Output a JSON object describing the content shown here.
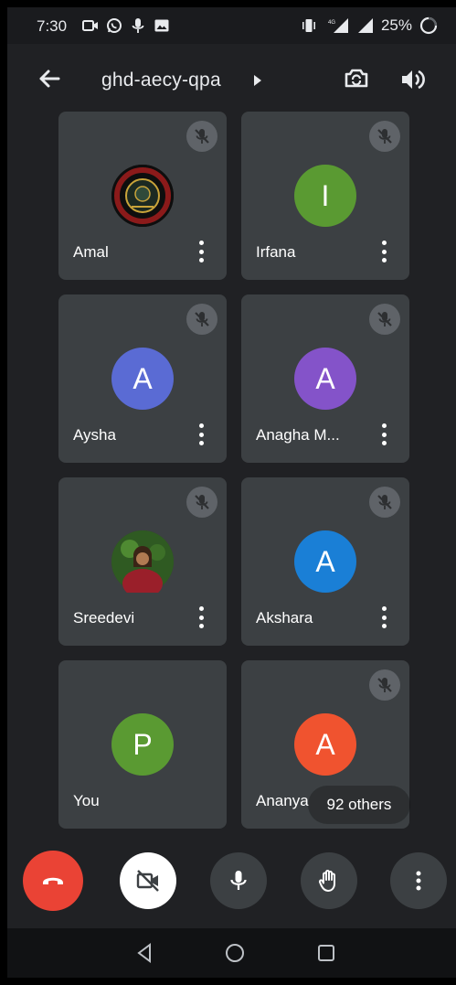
{
  "status_bar": {
    "time": "7:30",
    "battery": "25%",
    "left_icons": [
      "video-notification-icon",
      "whatsapp-icon",
      "mic-notification-icon",
      "gallery-icon"
    ],
    "right_icons": [
      "vibrate-icon",
      "4g-signal-icon",
      "signal-icon",
      "battery-icon"
    ]
  },
  "header": {
    "meeting_code": "ghd-aecy-qpa"
  },
  "participants": [
    {
      "name": "Amal",
      "avatar_type": "image",
      "muted": true
    },
    {
      "name": "Irfana",
      "initial": "I",
      "color": "#5a9a32",
      "muted": true
    },
    {
      "name": "Aysha",
      "initial": "A",
      "color": "#5a6bd4",
      "muted": true
    },
    {
      "name": "Anagha M...",
      "initial": "A",
      "color": "#8453c9",
      "muted": true
    },
    {
      "name": "Sreedevi",
      "avatar_type": "image",
      "muted": true
    },
    {
      "name": "Akshara",
      "initial": "A",
      "color": "#1a7fd6",
      "muted": true
    },
    {
      "name": "You",
      "initial": "P",
      "color": "#5a9a32",
      "muted": false
    },
    {
      "name": "Ananya",
      "initial": "A",
      "color": "#f0532f",
      "muted": true
    }
  ],
  "others_chip": "92 others",
  "colors": {
    "background": "#202124",
    "tile": "#3c4043",
    "end_call": "#ea4335"
  }
}
